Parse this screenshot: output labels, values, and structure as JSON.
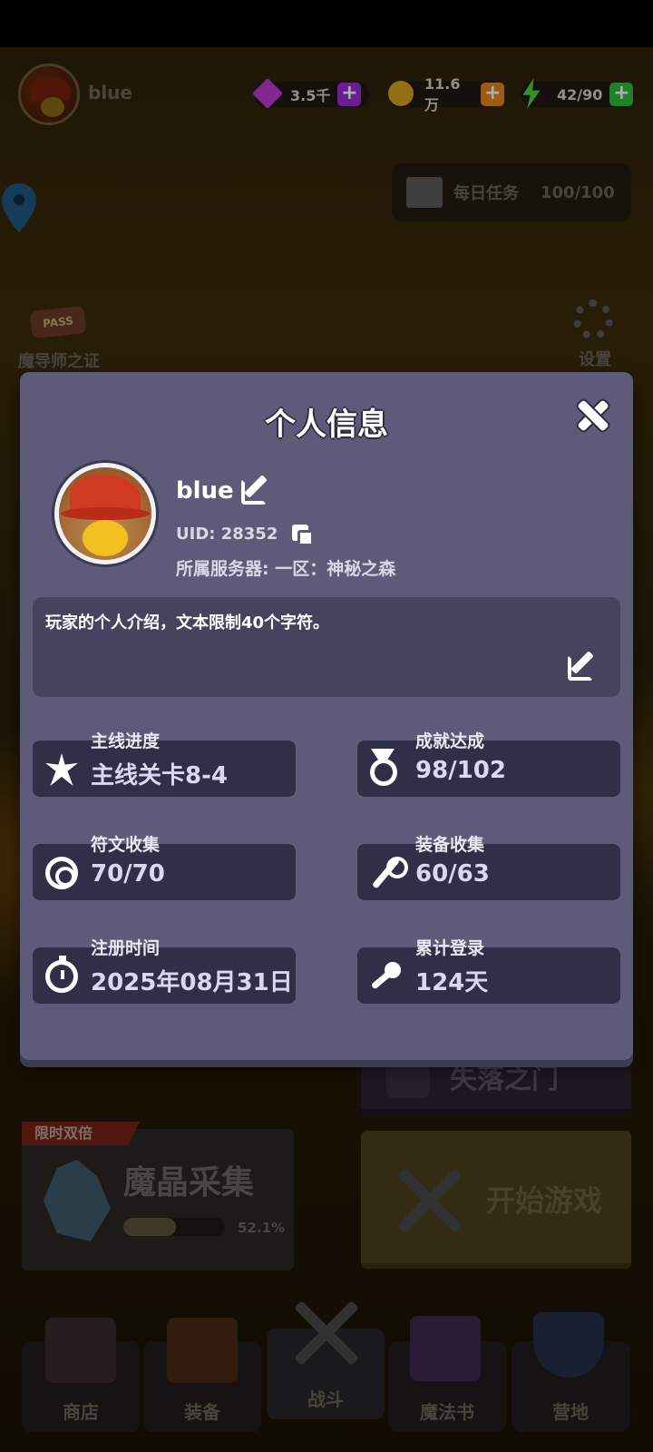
{
  "top_bar": {
    "player_name": "blue",
    "gems": "3.5千",
    "coins": "11.6万",
    "energy": "42/90",
    "plus_symbol": "+"
  },
  "daily_tasks": {
    "label": "每日任务",
    "count": "100/100"
  },
  "pass": {
    "badge": "PASS",
    "label": "魔导师之证"
  },
  "settings": {
    "label": "设置"
  },
  "lost_gate": {
    "label": "失落之门"
  },
  "crystal": {
    "tag": "限时双倍",
    "title": "魔晶采集",
    "progress_label": "52.1%",
    "progress": 0.521
  },
  "start_game": {
    "label": "开始游戏"
  },
  "nav": [
    {
      "label": "商店",
      "icon": "shop-icon"
    },
    {
      "label": "装备",
      "icon": "backpack-icon"
    },
    {
      "label": "战斗",
      "icon": "crossed-swords-icon"
    },
    {
      "label": "魔法书",
      "icon": "spellbook-icon"
    },
    {
      "label": "营地",
      "icon": "shield-crown-icon"
    }
  ],
  "modal": {
    "title": "个人信息",
    "name": "blue",
    "uid": "UID: 28352",
    "server": "所属服务器: 一区：神秘之森",
    "bio": "玩家的个人介绍，文本限制40个字符。",
    "stats": [
      {
        "label": "主线进度",
        "value": "主线关卡8-4",
        "icon": "burst-icon"
      },
      {
        "label": "成就达成",
        "value": "98/102",
        "icon": "medal-icon"
      },
      {
        "label": "符文收集",
        "value": "70/70",
        "icon": "rune-icon"
      },
      {
        "label": "装备收集",
        "value": "60/63",
        "icon": "staff-icon"
      },
      {
        "label": "注册时间",
        "value": "2025年08月31日",
        "icon": "stopwatch-icon"
      },
      {
        "label": "累计登录",
        "value": "124天",
        "icon": "key-icon"
      }
    ]
  },
  "colors": {
    "modal_bg": "#5c5c7a",
    "stat_bg": "#2f2f47",
    "gem_plus": "#9b2fd6",
    "coin_plus": "#e58a1c",
    "energy_plus": "#2fbf3c"
  }
}
